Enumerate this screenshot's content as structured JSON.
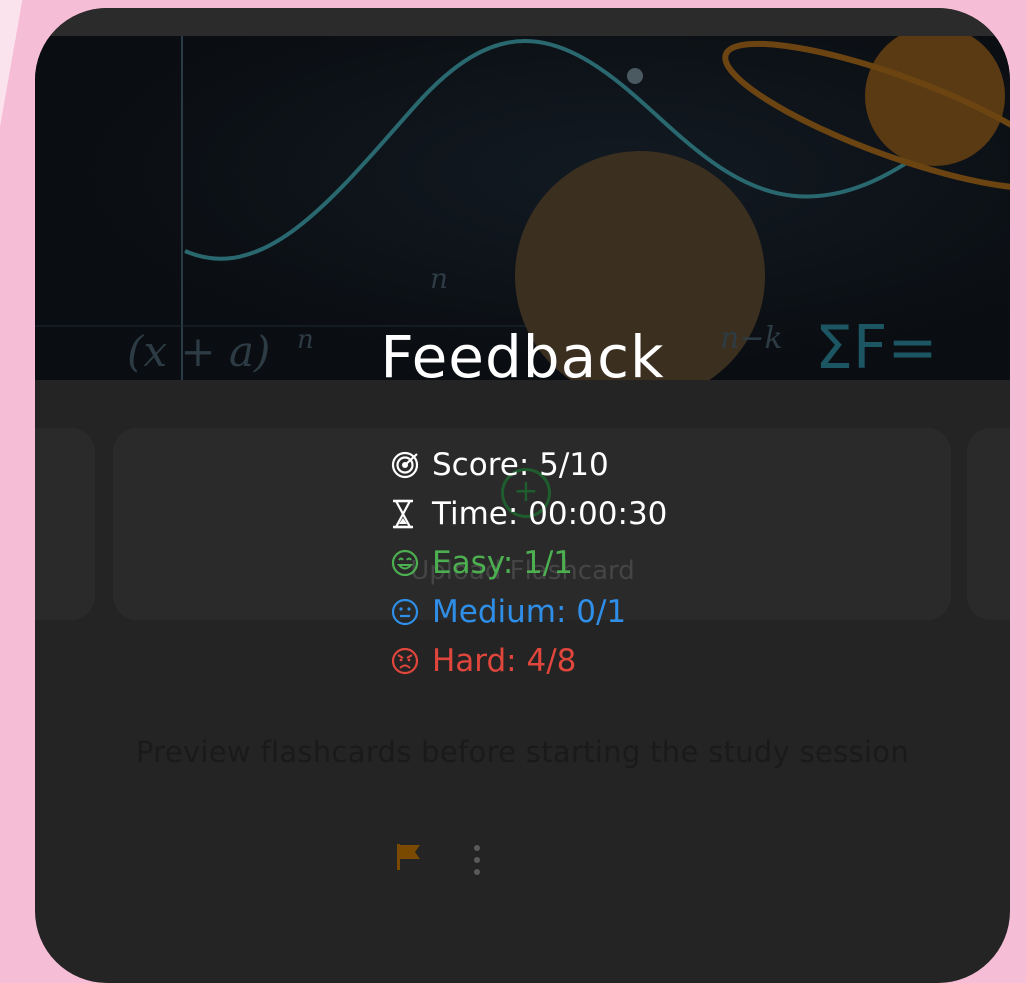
{
  "feedback": {
    "title": "Feedback",
    "score": {
      "label": "Score: 5/10",
      "icon": "target-icon"
    },
    "time": {
      "label": "Time: 00:00:30",
      "icon": "hourglass-icon"
    },
    "easy": {
      "label": "Easy: 1/1",
      "icon": "smile-icon",
      "color": "#4caf50"
    },
    "medium": {
      "label": "Medium: 0/1",
      "icon": "neutral-face-icon",
      "color": "#2f8fe8"
    },
    "hard": {
      "label": "Hard: 4/8",
      "icon": "angry-face-icon",
      "color": "#e0463c"
    }
  },
  "background": {
    "upload_label": "Upload Flashcard",
    "preview_text": "Preview flashcards before starting the study session",
    "hero_formula_left": "(x + a)",
    "hero_formula_exp": "n",
    "hero_sum_top": "n",
    "hero_sum_right": "n−k",
    "hero_sigma": "ΣF="
  },
  "colors": {
    "page_bg": "#f6bdd6",
    "panel_bg": "#242424",
    "flag": "#7a4a00"
  }
}
